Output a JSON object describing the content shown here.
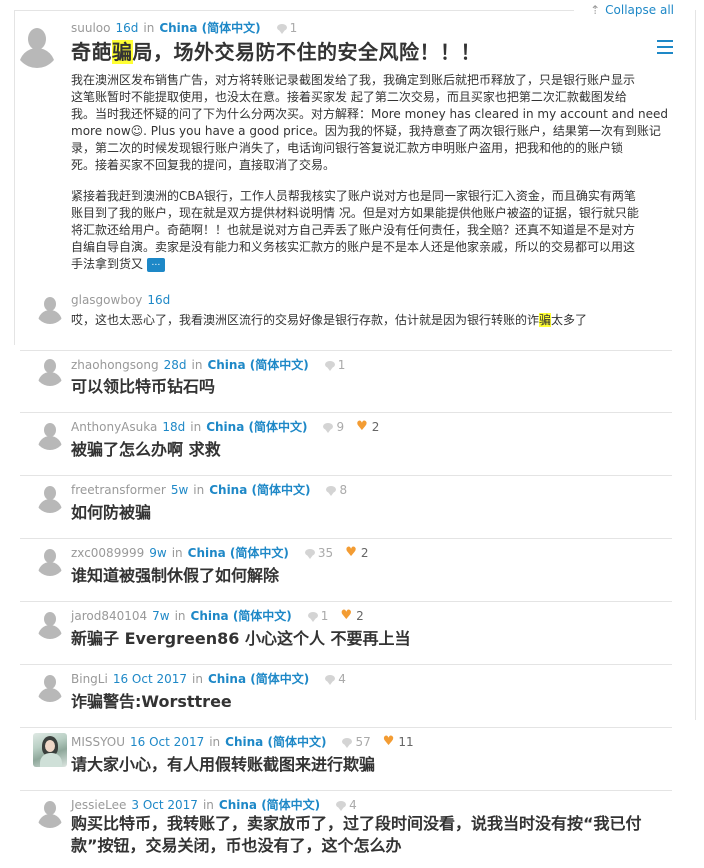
{
  "header": {
    "collapse_all": "Collapse all",
    "collapse_arrow": "⇡"
  },
  "main_post": {
    "user": "suuloo",
    "time": "16d",
    "in": "in",
    "category": "China (简体中文)",
    "comments": "1",
    "title_pre": "奇葩",
    "title_hl": "骗",
    "title_post": "局，场外交易防不住的安全风险！！！",
    "para1_lines": [
      "我在澳洲区发布销售广告，对方将转账记录截图发给了我，我确定到账后就把币释放了，只是银行账户显示",
      "这笔账暂时不能提取使用，也没太在意。接着买家发 起了第二次交易，而且买家也把第二次汇款截图发给",
      "我。当时我还怀疑的问了下为什么分两次买。对方解释：More money has cleared in my account and need",
      "more now☺. Plus you have a good price。因为我的怀疑，我持意查了两次银行账户，结果第一次有到账记",
      "录，第二次的时候发现银行账户消失了，电话询问银行答复说汇款方申明账户盗用，把我和他的的账户锁",
      "死。接着买家不回复我的提问，直接取消了交易。"
    ],
    "para2_lines": [
      "紧接着我赶到澳洲的CBA银行，工作人员帮我核实了账户说对方也是同一家银行汇入资金，而且确实有两笔",
      "账目到了我的账户，现在就是双方提供材料说明情 况。但是对方如果能提供他账户被盗的证据，银行就只能",
      "将汇款还给用户。奇葩啊！！也就是说对方自己弄丢了账户没有任何责任，我全赔？还真不知道是不是对方",
      "自编自导自演。卖家是没有能力和义务核实汇款方的账户是不是本人还是他家亲戚，所以的交易都可以用这",
      "手法拿到货又"
    ],
    "more_label": "…"
  },
  "reply": {
    "user": "glasgowboy",
    "time": "16d",
    "text_pre": "哎，这也太恶心了，我看澳洲区流行的交易好像是银行存款，估计就是因为银行转账的诈",
    "text_hl": "骗",
    "text_post": "太多了"
  },
  "threads": [
    {
      "user": "zhaohongsong",
      "time": "28d",
      "in": "in",
      "category": "China (简体中文)",
      "comments": "1",
      "likes": "",
      "title": "可以领比特币钻石吗"
    },
    {
      "user": "AnthonyAsuka",
      "time": "18d",
      "in": "in",
      "category": "China (简体中文)",
      "comments": "9",
      "likes": "2",
      "title": "被骗了怎么办啊 求救"
    },
    {
      "user": "freetransformer",
      "time": "5w",
      "in": "in",
      "category": "China (简体中文)",
      "comments": "8",
      "likes": "",
      "title": "如何防被骗"
    },
    {
      "user": "zxc0089999",
      "time": "9w",
      "in": "in",
      "category": "China (简体中文)",
      "comments": "35",
      "likes": "2",
      "title": "谁知道被强制休假了如何解除"
    },
    {
      "user": "jarod840104",
      "time": "7w",
      "in": "in",
      "category": "China (简体中文)",
      "comments": "1",
      "likes": "2",
      "title": "新骗子 Evergreen86 小心这个人 不要再上当"
    },
    {
      "user": "BingLi",
      "time": "16 Oct 2017",
      "in": "in",
      "category": "China (简体中文)",
      "comments": "4",
      "likes": "",
      "title": "诈骗警告:Worsttree"
    },
    {
      "user": "MISSYOU",
      "time": "16 Oct 2017",
      "in": "in",
      "category": "China (简体中文)",
      "comments": "57",
      "likes": "11",
      "title": "请大家小心，有人用假转账截图来进行欺骗"
    },
    {
      "user": "JessieLee",
      "time": "3 Oct 2017",
      "in": "in",
      "category": "China (简体中文)",
      "comments": "4",
      "likes": "",
      "title_lines": [
        "购买比特币，我转账了，卖家放币了，过了段时间没看，说我当时没有按“我已付",
        "款”按钮，交易关闭，币也没有了，这个怎么办"
      ]
    }
  ]
}
